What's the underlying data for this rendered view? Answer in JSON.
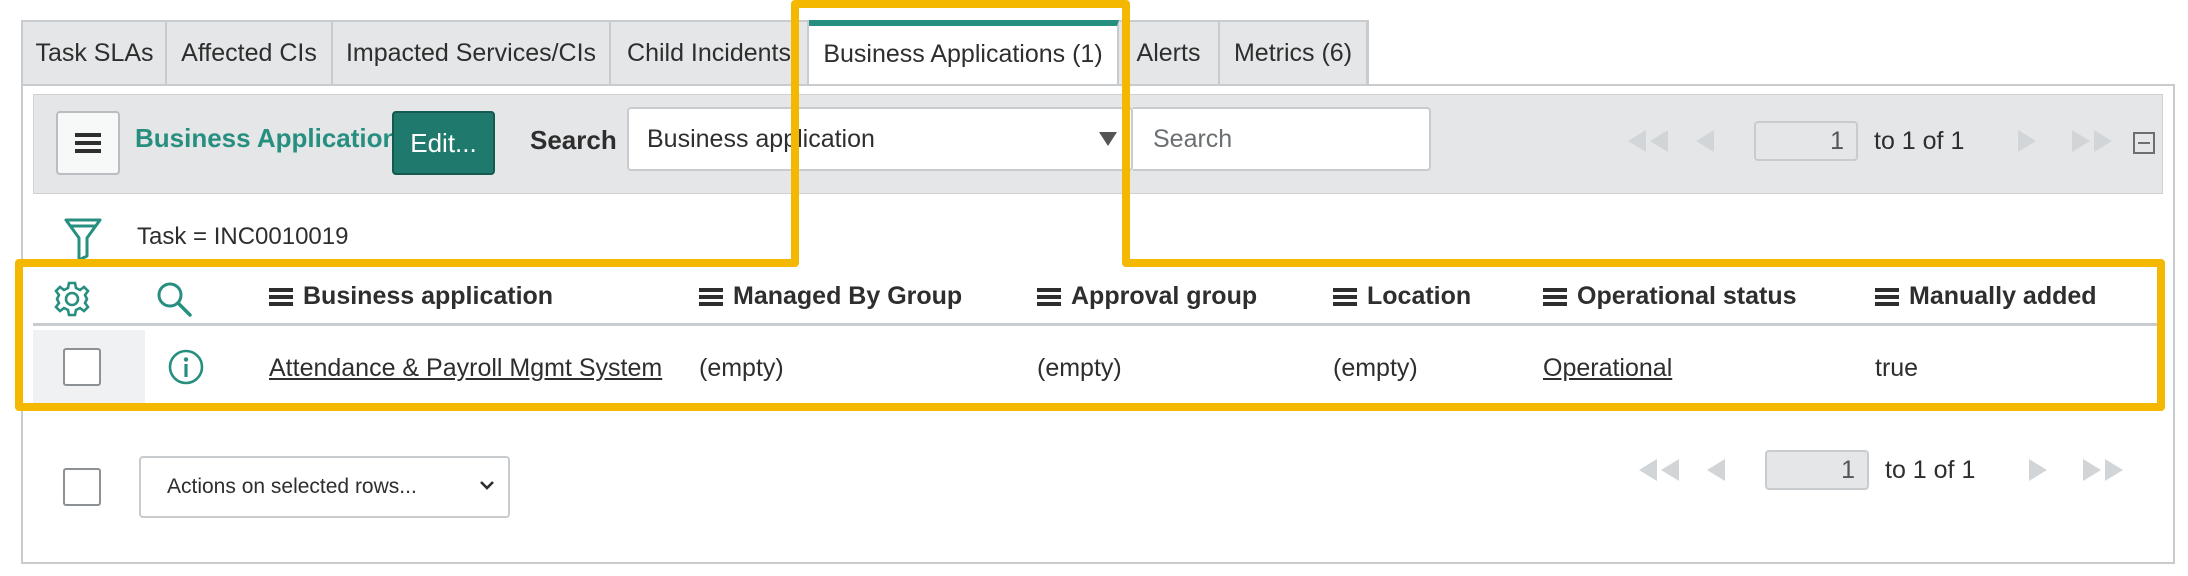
{
  "tabs": [
    {
      "label": "Task SLAs"
    },
    {
      "label": "Affected CIs"
    },
    {
      "label": "Impacted Services/CIs"
    },
    {
      "label": "Child Incidents"
    },
    {
      "label": "Business Applications (1)"
    },
    {
      "label": "Alerts"
    },
    {
      "label": "Metrics (6)"
    }
  ],
  "toolbar": {
    "list_title": "Business Applications",
    "edit_label": "Edit...",
    "search_label": "Search",
    "search_field": "Business application",
    "search_placeholder": "Search"
  },
  "pager_top": {
    "page": "1",
    "range": "to 1 of 1"
  },
  "filter": {
    "breadcrumb": "Task = INC0010019"
  },
  "table": {
    "columns": [
      "Business application",
      "Managed By Group",
      "Approval group",
      "Location",
      "Operational status",
      "Manually added"
    ],
    "rows": [
      {
        "business_application": "Attendance & Payroll Mgmt System",
        "managed_by_group": "(empty)",
        "approval_group": "(empty)",
        "location": "(empty)",
        "operational_status": "Operational",
        "manually_added": "true"
      }
    ]
  },
  "footer": {
    "actions_label": "Actions on selected rows..."
  },
  "pager_bottom": {
    "page": "1",
    "range": "to 1 of 1"
  },
  "colors": {
    "accent": "#278f7f",
    "button": "#1f7a6d",
    "highlight": "#f5b800"
  }
}
